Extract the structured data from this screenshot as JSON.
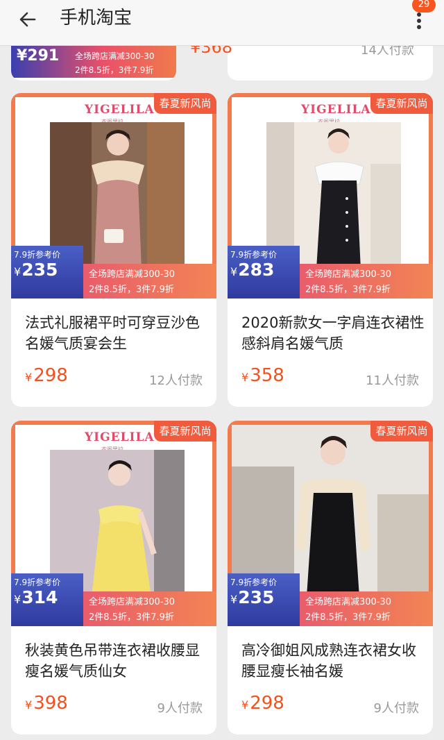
{
  "header": {
    "title": "手机淘宝",
    "back_icon": "arrow-left-icon",
    "more_icon": "more-vertical-icon",
    "badge_count": "29"
  },
  "partial_row": {
    "left_price": "¥291",
    "left_promo1": "全场跨店满减300-30",
    "left_promo2": "2件8.5折，3件7.9折",
    "right_price": "¥368",
    "right_paid": "14人付款"
  },
  "colors": {
    "accent": "#f4511e",
    "brand": "#e24a6a",
    "band_blue": "#2f3a9e"
  },
  "products": [
    {
      "brand": "YIGELILA",
      "brand_sub": "衣阁里拉",
      "season_tag": "春夏新风尚",
      "ref_label": "7.9折参考价",
      "ref_currency": "¥",
      "ref_price": "235",
      "promo1": "全场跨店满减300-30",
      "promo2": "2件8.5折，3件7.9折",
      "name": "法式礼服裙平时可穿豆沙色名媛气质宴会生",
      "currency": "¥",
      "price": "298",
      "paid": "12人付款"
    },
    {
      "brand": "YIGELILA",
      "brand_sub": "衣阁里拉",
      "season_tag": "春夏新风尚",
      "ref_label": "7.9折参考价",
      "ref_currency": "¥",
      "ref_price": "283",
      "promo1": "全场跨店满减300-30",
      "promo2": "2件8.5折，3件7.9折",
      "name": "2020新款女一字肩连衣裙性感斜肩名媛气质",
      "currency": "¥",
      "price": "358",
      "paid": "11人付款"
    },
    {
      "brand": "YIGELILA",
      "brand_sub": "衣阁里拉",
      "season_tag": "春夏新风尚",
      "ref_label": "7.9折参考价",
      "ref_currency": "¥",
      "ref_price": "314",
      "promo1": "全场跨店满减300-30",
      "promo2": "2件8.5折，3件7.9折",
      "name": "秋装黄色吊带连衣裙收腰显瘦名媛气质仙女",
      "currency": "¥",
      "price": "398",
      "paid": "9人付款"
    },
    {
      "brand": "",
      "brand_sub": "",
      "season_tag": "春夏新风尚",
      "ref_label": "7.9折参考价",
      "ref_currency": "¥",
      "ref_price": "235",
      "promo1": "全场跨店满减300-30",
      "promo2": "2件8.5折，3件7.9折",
      "name": "高冷御姐风成熟连衣裙女收腰显瘦长袖名媛",
      "currency": "¥",
      "price": "298",
      "paid": "9人付款"
    }
  ]
}
